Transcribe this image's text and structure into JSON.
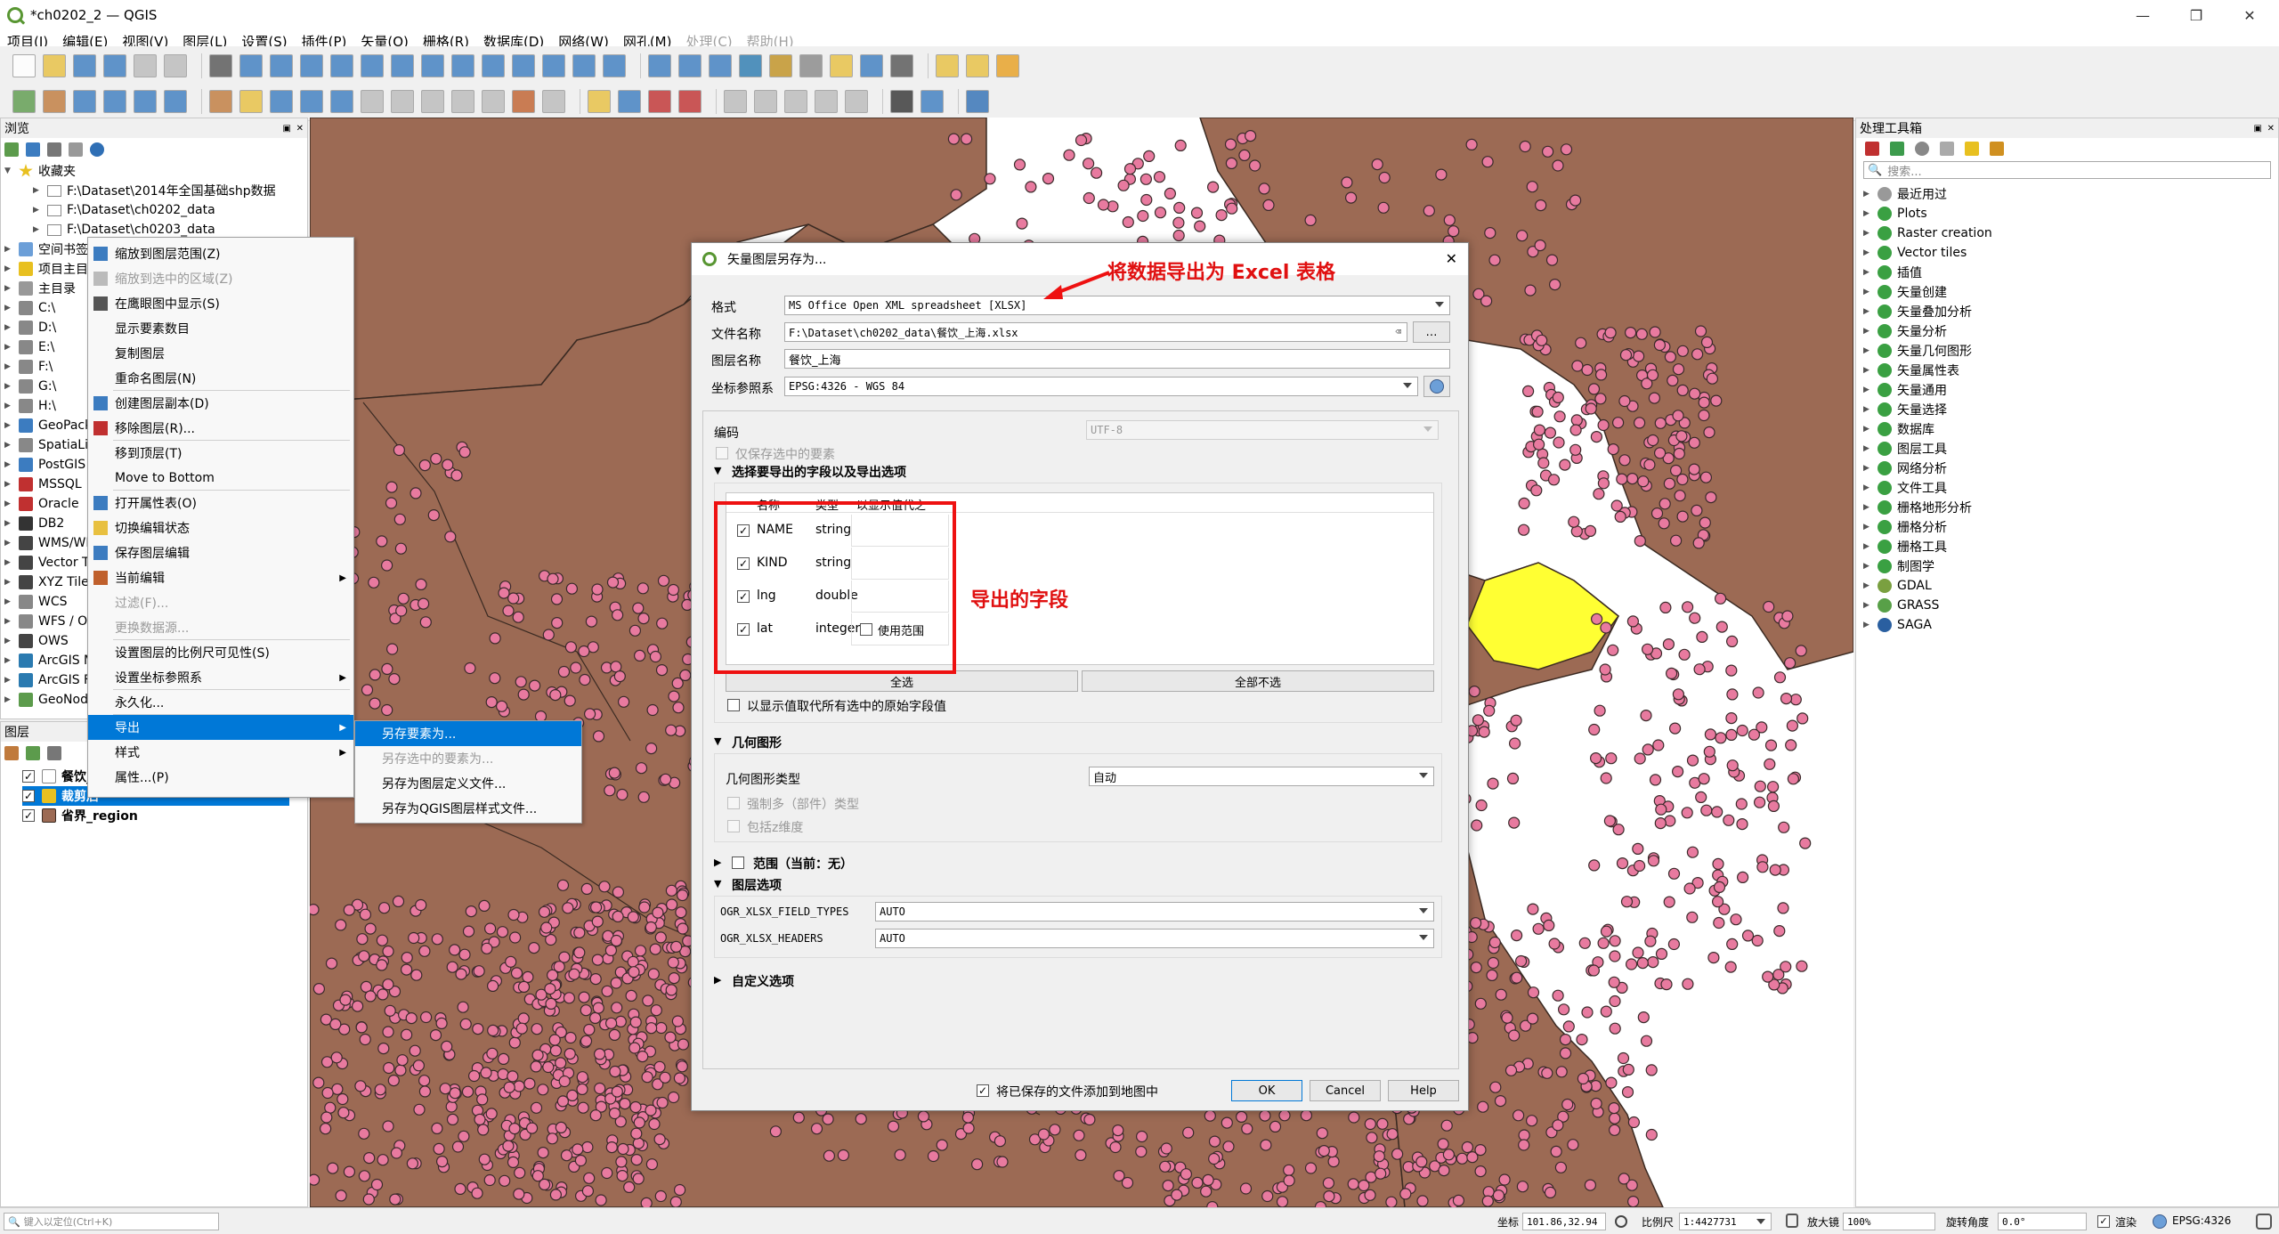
{
  "window": {
    "title": "*ch0202_2 — QGIS",
    "controls": [
      "—",
      "❐",
      "✕"
    ]
  },
  "menubar": [
    {
      "label": "项目(J)",
      "disabled": false
    },
    {
      "label": "编辑(E)",
      "disabled": false
    },
    {
      "label": "视图(V)",
      "disabled": false
    },
    {
      "label": "图层(L)",
      "disabled": false
    },
    {
      "label": "设置(S)",
      "disabled": false
    },
    {
      "label": "插件(P)",
      "disabled": false
    },
    {
      "label": "矢量(O)",
      "disabled": false
    },
    {
      "label": "栅格(R)",
      "disabled": false
    },
    {
      "label": "数据库(D)",
      "disabled": false
    },
    {
      "label": "网络(W)",
      "disabled": false
    },
    {
      "label": "网孔(M)",
      "disabled": false
    },
    {
      "label": "处理(C)",
      "disabled": true
    },
    {
      "label": "帮助(H)",
      "disabled": true
    }
  ],
  "browser": {
    "title": "浏览",
    "favorites_label": "收藏夹",
    "favorites": [
      "F:\\Dataset\\2014年全国基础shp数据",
      "F:\\Dataset\\ch0202_data",
      "F:\\Dataset\\ch0203_data"
    ],
    "items": [
      "空间书签",
      "项目主目录",
      "主目录",
      "C:\\",
      "D:\\",
      "E:\\",
      "F:\\",
      "G:\\",
      "H:\\",
      "GeoPackage",
      "SpatiaLite",
      "PostGIS",
      "MSSQL",
      "Oracle",
      "DB2",
      "WMS/WMTS",
      "Vector Tiles",
      "XYZ Tiles",
      "WCS",
      "WFS / OGC API",
      "OWS",
      "ArcGIS Map Service",
      "ArcGIS Feature Service",
      "GeoNode"
    ]
  },
  "layers_panel": {
    "title": "图层",
    "layers": [
      {
        "name": "餐饮_上海",
        "checked": true
      },
      {
        "name": "裁剪后",
        "checked": true
      },
      {
        "name": "省界_region",
        "checked": true
      }
    ]
  },
  "context_menu": {
    "items": [
      {
        "label": "缩放到图层范围(Z)",
        "disabled": false
      },
      {
        "label": "缩放到选中的区域(Z)",
        "disabled": true
      },
      {
        "label": "在鹰眼图中显示(S)",
        "disabled": false
      },
      {
        "label": "显示要素数目",
        "disabled": false
      },
      {
        "label": "复制图层",
        "disabled": false
      },
      {
        "label": "重命名图层(N)",
        "disabled": false
      },
      {
        "label": "创建图层副本(D)",
        "disabled": false
      },
      {
        "label": "移除图层(R)...",
        "disabled": false
      },
      {
        "label": "移到顶层(T)",
        "disabled": false
      },
      {
        "label": "Move to Bottom",
        "disabled": false
      },
      {
        "label": "打开属性表(O)",
        "disabled": false
      },
      {
        "label": "切换编辑状态",
        "disabled": false
      },
      {
        "label": "保存图层编辑",
        "disabled": false
      },
      {
        "label": "当前编辑",
        "disabled": false
      },
      {
        "label": "过滤(F)...",
        "disabled": true
      },
      {
        "label": "更换数据源...",
        "disabled": true
      },
      {
        "label": "设置图层的比例尺可见性(S)",
        "disabled": false
      },
      {
        "label": "设置坐标参照系",
        "disabled": false
      },
      {
        "label": "永久化...",
        "disabled": false
      },
      {
        "label": "导出",
        "disabled": false
      },
      {
        "label": "样式",
        "disabled": false
      },
      {
        "label": "属性...(P)",
        "disabled": false
      }
    ],
    "submenu": [
      {
        "label": "另存要素为...",
        "disabled": false
      },
      {
        "label": "另存选中的要素为...",
        "disabled": true
      },
      {
        "label": "另存为图层定义文件...",
        "disabled": false
      },
      {
        "label": "另存为QGIS图层样式文件...",
        "disabled": false
      }
    ]
  },
  "dialog": {
    "title": "矢量图层另存为...",
    "format_label": "格式",
    "format_value": "MS Office Open XML spreadsheet [XLSX]",
    "filename_label": "文件名称",
    "filename_value": "F:\\Dataset\\ch0202_data\\餐饮_上海.xlsx",
    "browse_label": "…",
    "layername_label": "图层名称",
    "layername_value": "餐饮_上海",
    "crs_label": "坐标参照系",
    "crs_value": "EPSG:4326 - WGS 84",
    "encoding_label": "编码",
    "encoding_value": "UTF-8",
    "save_selected_label": "仅保存选中的要素",
    "fields_section": "选择要导出的字段以及导出选项",
    "fields_headers": [
      "名称",
      "类型",
      "以显示值代之"
    ],
    "fields": [
      {
        "name": "NAME",
        "type": "string",
        "checked": true,
        "extra": ""
      },
      {
        "name": "KIND",
        "type": "string",
        "checked": true,
        "extra": ""
      },
      {
        "name": "lng",
        "type": "double",
        "checked": true,
        "extra": ""
      },
      {
        "name": "lat",
        "type": "integer",
        "checked": true,
        "extra": "使用范围"
      }
    ],
    "select_all": "全选",
    "deselect_all": "全部不选",
    "replace_label": "以显示值取代所有选中的原始字段值",
    "geometry_section": "几何图形",
    "geometry_type_label": "几何图形类型",
    "geometry_type_value": "自动",
    "force_multi_label": "强制多（部件）类型",
    "include_z_label": "包括z维度",
    "extent_section": "范围（当前：无）",
    "layer_options_section": "图层选项",
    "layer_options": [
      {
        "name": "OGR_XLSX_FIELD_TYPES",
        "value": "AUTO"
      },
      {
        "name": "OGR_XLSX_HEADERS",
        "value": "AUTO"
      }
    ],
    "custom_section": "自定义选项",
    "add_to_map_label": "将已保存的文件添加到地图中",
    "ok": "OK",
    "cancel": "Cancel",
    "help": "Help"
  },
  "annotations": {
    "format_note": "将数据导出为 Excel 表格",
    "fields_note": "导出的字段"
  },
  "toolbox": {
    "title": "处理工具箱",
    "search_placeholder": "搜索...",
    "items": [
      "最近用过",
      "Plots",
      "Raster creation",
      "Vector tiles",
      "插值",
      "矢量创建",
      "矢量叠加分析",
      "矢量分析",
      "矢量几何图形",
      "矢量属性表",
      "矢量通用",
      "矢量选择",
      "数据库",
      "图层工具",
      "网络分析",
      "文件工具",
      "栅格地形分析",
      "栅格分析",
      "栅格工具",
      "制图学",
      "GDAL",
      "GRASS",
      "SAGA"
    ]
  },
  "statusbar": {
    "locator_placeholder": "键入以定位(Ctrl+K)",
    "coord_label": "坐标",
    "coord_value": "101.86,32.94",
    "scale_label": "比例尺",
    "scale_value": "1:4427731",
    "magnifier_label": "放大镜",
    "magnifier_value": "100%",
    "rotation_label": "旋转角度",
    "rotation_value": "0.0°",
    "render_label": "渲染",
    "crs_value": "EPSG:4326"
  },
  "colors": {
    "land": "#9c6a54",
    "points": "#e87a9f",
    "highlight": "#ffff33",
    "annotation": "#e11111",
    "selection": "#0078d7"
  }
}
